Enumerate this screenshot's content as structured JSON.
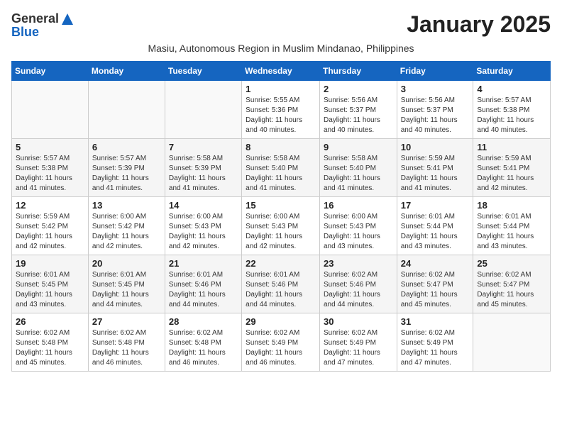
{
  "logo": {
    "general": "General",
    "blue": "Blue"
  },
  "title": "January 2025",
  "subtitle": "Masiu, Autonomous Region in Muslim Mindanao, Philippines",
  "weekdays": [
    "Sunday",
    "Monday",
    "Tuesday",
    "Wednesday",
    "Thursday",
    "Friday",
    "Saturday"
  ],
  "weeks": [
    [
      {
        "day": "",
        "info": ""
      },
      {
        "day": "",
        "info": ""
      },
      {
        "day": "",
        "info": ""
      },
      {
        "day": "1",
        "info": "Sunrise: 5:55 AM\nSunset: 5:36 PM\nDaylight: 11 hours\nand 40 minutes."
      },
      {
        "day": "2",
        "info": "Sunrise: 5:56 AM\nSunset: 5:37 PM\nDaylight: 11 hours\nand 40 minutes."
      },
      {
        "day": "3",
        "info": "Sunrise: 5:56 AM\nSunset: 5:37 PM\nDaylight: 11 hours\nand 40 minutes."
      },
      {
        "day": "4",
        "info": "Sunrise: 5:57 AM\nSunset: 5:38 PM\nDaylight: 11 hours\nand 40 minutes."
      }
    ],
    [
      {
        "day": "5",
        "info": "Sunrise: 5:57 AM\nSunset: 5:38 PM\nDaylight: 11 hours\nand 41 minutes."
      },
      {
        "day": "6",
        "info": "Sunrise: 5:57 AM\nSunset: 5:39 PM\nDaylight: 11 hours\nand 41 minutes."
      },
      {
        "day": "7",
        "info": "Sunrise: 5:58 AM\nSunset: 5:39 PM\nDaylight: 11 hours\nand 41 minutes."
      },
      {
        "day": "8",
        "info": "Sunrise: 5:58 AM\nSunset: 5:40 PM\nDaylight: 11 hours\nand 41 minutes."
      },
      {
        "day": "9",
        "info": "Sunrise: 5:58 AM\nSunset: 5:40 PM\nDaylight: 11 hours\nand 41 minutes."
      },
      {
        "day": "10",
        "info": "Sunrise: 5:59 AM\nSunset: 5:41 PM\nDaylight: 11 hours\nand 41 minutes."
      },
      {
        "day": "11",
        "info": "Sunrise: 5:59 AM\nSunset: 5:41 PM\nDaylight: 11 hours\nand 42 minutes."
      }
    ],
    [
      {
        "day": "12",
        "info": "Sunrise: 5:59 AM\nSunset: 5:42 PM\nDaylight: 11 hours\nand 42 minutes."
      },
      {
        "day": "13",
        "info": "Sunrise: 6:00 AM\nSunset: 5:42 PM\nDaylight: 11 hours\nand 42 minutes."
      },
      {
        "day": "14",
        "info": "Sunrise: 6:00 AM\nSunset: 5:43 PM\nDaylight: 11 hours\nand 42 minutes."
      },
      {
        "day": "15",
        "info": "Sunrise: 6:00 AM\nSunset: 5:43 PM\nDaylight: 11 hours\nand 42 minutes."
      },
      {
        "day": "16",
        "info": "Sunrise: 6:00 AM\nSunset: 5:43 PM\nDaylight: 11 hours\nand 43 minutes."
      },
      {
        "day": "17",
        "info": "Sunrise: 6:01 AM\nSunset: 5:44 PM\nDaylight: 11 hours\nand 43 minutes."
      },
      {
        "day": "18",
        "info": "Sunrise: 6:01 AM\nSunset: 5:44 PM\nDaylight: 11 hours\nand 43 minutes."
      }
    ],
    [
      {
        "day": "19",
        "info": "Sunrise: 6:01 AM\nSunset: 5:45 PM\nDaylight: 11 hours\nand 43 minutes."
      },
      {
        "day": "20",
        "info": "Sunrise: 6:01 AM\nSunset: 5:45 PM\nDaylight: 11 hours\nand 44 minutes."
      },
      {
        "day": "21",
        "info": "Sunrise: 6:01 AM\nSunset: 5:46 PM\nDaylight: 11 hours\nand 44 minutes."
      },
      {
        "day": "22",
        "info": "Sunrise: 6:01 AM\nSunset: 5:46 PM\nDaylight: 11 hours\nand 44 minutes."
      },
      {
        "day": "23",
        "info": "Sunrise: 6:02 AM\nSunset: 5:46 PM\nDaylight: 11 hours\nand 44 minutes."
      },
      {
        "day": "24",
        "info": "Sunrise: 6:02 AM\nSunset: 5:47 PM\nDaylight: 11 hours\nand 45 minutes."
      },
      {
        "day": "25",
        "info": "Sunrise: 6:02 AM\nSunset: 5:47 PM\nDaylight: 11 hours\nand 45 minutes."
      }
    ],
    [
      {
        "day": "26",
        "info": "Sunrise: 6:02 AM\nSunset: 5:48 PM\nDaylight: 11 hours\nand 45 minutes."
      },
      {
        "day": "27",
        "info": "Sunrise: 6:02 AM\nSunset: 5:48 PM\nDaylight: 11 hours\nand 46 minutes."
      },
      {
        "day": "28",
        "info": "Sunrise: 6:02 AM\nSunset: 5:48 PM\nDaylight: 11 hours\nand 46 minutes."
      },
      {
        "day": "29",
        "info": "Sunrise: 6:02 AM\nSunset: 5:49 PM\nDaylight: 11 hours\nand 46 minutes."
      },
      {
        "day": "30",
        "info": "Sunrise: 6:02 AM\nSunset: 5:49 PM\nDaylight: 11 hours\nand 47 minutes."
      },
      {
        "day": "31",
        "info": "Sunrise: 6:02 AM\nSunset: 5:49 PM\nDaylight: 11 hours\nand 47 minutes."
      },
      {
        "day": "",
        "info": ""
      }
    ]
  ]
}
